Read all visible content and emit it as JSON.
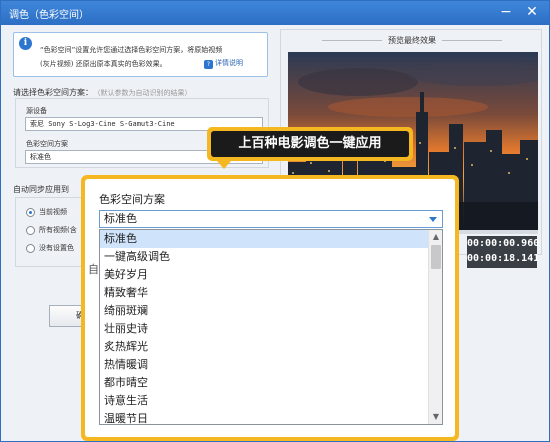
{
  "window": {
    "title": "调色（色彩空间）",
    "minimize_icon": "minimize-icon",
    "close_icon": "close-icon"
  },
  "info": {
    "icon": "info-icon",
    "line1": "“色彩空间”设置允许您通过选择色彩空间方案，将原始视频",
    "line2": "(灰片视频) 还原出原本真实的色彩效果。",
    "detail_link": "详情说明"
  },
  "scheme_section": {
    "label": "请选择色彩空间方案：",
    "hint": "（默认参数为自动识别的结果）",
    "device_label": "源设备",
    "device_value": "索尼 Sony S-Log3-Cine S-Gamut3-Cine",
    "scheme_label": "色彩空间方案",
    "scheme_value": "标准色"
  },
  "sync_section": {
    "label": "自动同步应用到",
    "options": [
      "当前视频",
      "所有视频(含",
      "没有设置色"
    ],
    "selected_index": 0
  },
  "confirm_button": "确定",
  "preview": {
    "title": "预览最终效果",
    "progress_fraction": 0.04,
    "time_current": "00:00:00.960",
    "time_total": "00:00:18.141"
  },
  "callout": {
    "text": "上百种电影调色一键应用"
  },
  "zoom": {
    "label": "色彩空间方案",
    "bg_text": "自动",
    "select_value": "标准色",
    "selected_index": 0,
    "items": [
      "标准色",
      "一键高级调色",
      "美好岁月",
      "精致奢华",
      "绮丽斑斓",
      "壮丽史诗",
      "炙热辉光",
      "热情暖调",
      "都市晴空",
      "诗意生活",
      "温暖节日"
    ]
  },
  "colors": {
    "accent": "#2c76cf",
    "highlight": "#f5b820",
    "callout_bg": "#1b1b1b"
  }
}
